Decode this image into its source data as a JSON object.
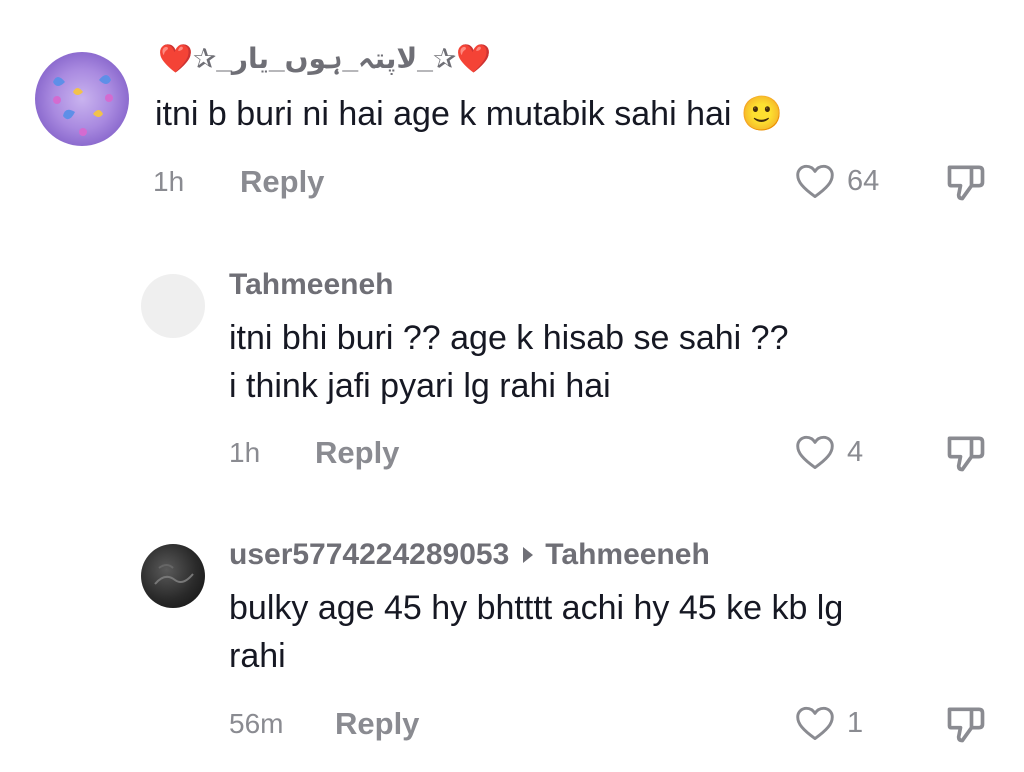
{
  "comments": [
    {
      "username": "❤️✰_لاپتہ_ہوں_یار_✰❤️",
      "text_lines": [
        "itni b buri ni hai age k mutabik sahi hai 🙂"
      ],
      "time": "1h",
      "reply_label": "Reply",
      "likes": "64"
    },
    {
      "username": "Tahmeeneh",
      "text_lines": [
        "itni bhi buri ?? age k hisab se sahi ??",
        "i think jafi pyari lg rahi hai"
      ],
      "time": "1h",
      "reply_label": "Reply",
      "likes": "4"
    },
    {
      "username": "user5774224289053",
      "reply_to": "Tahmeeneh",
      "text_lines": [
        "bulky age 45 hy bhtttt achi hy 45 ke kb lg",
        "rahi"
      ],
      "time": "56m",
      "reply_label": "Reply",
      "likes": "1"
    }
  ],
  "colors": {
    "text": "#161823",
    "muted": "#8a8b91",
    "username": "#6f6f76"
  },
  "icons": {
    "like": "heart-outline-icon",
    "dislike": "thumbs-down-icon"
  }
}
